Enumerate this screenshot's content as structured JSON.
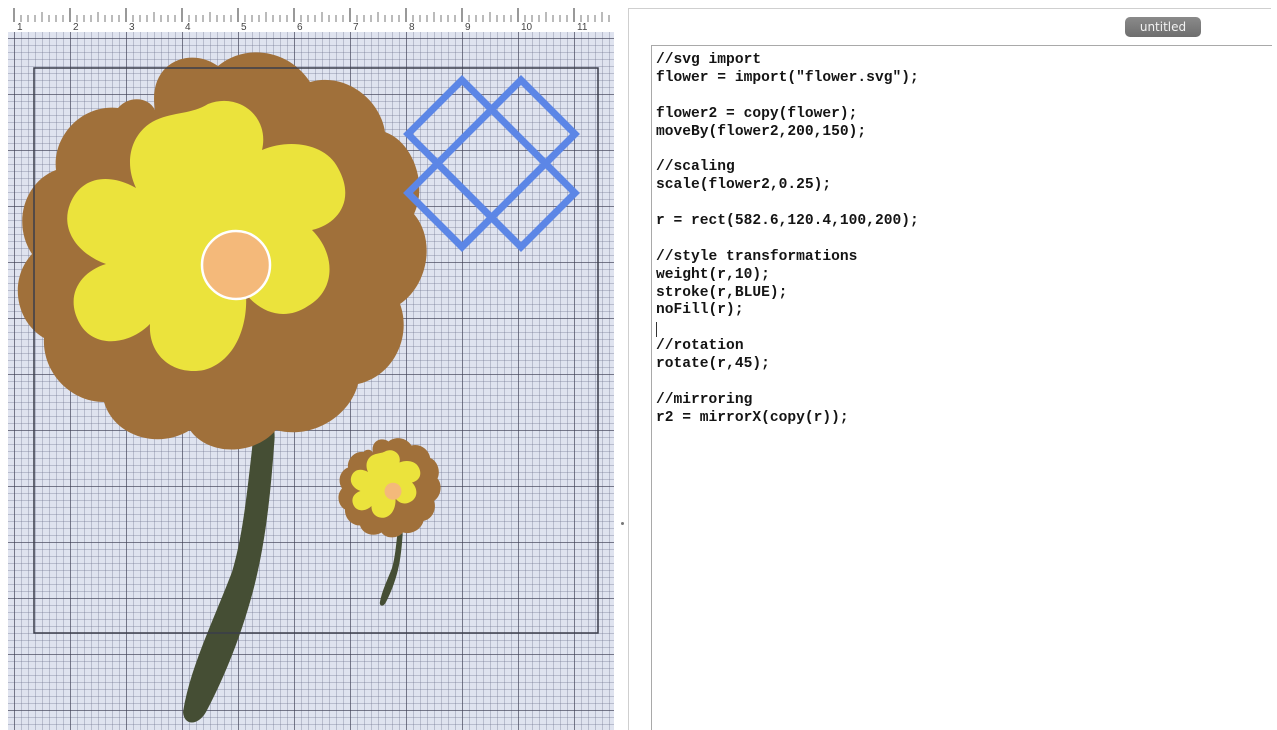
{
  "ruler": {
    "labels": [
      "1",
      "2",
      "3",
      "4",
      "5",
      "6",
      "7",
      "8",
      "9",
      "10",
      "11"
    ]
  },
  "canvas": {
    "shapes": [
      "frame-rect",
      "flower",
      "flower2",
      "r",
      "r2"
    ],
    "colors": {
      "petal_outer": "#a0703a",
      "petal_inner": "#ebe33c",
      "center": "#f4b97a",
      "stem": "#454e34",
      "rect_stroke": "#5c86e6",
      "grid_bg": "#dfe3ef"
    }
  },
  "editor": {
    "tab_label": "untitled",
    "code_lines": [
      "//svg import",
      "flower = import(\"flower.svg\");",
      "",
      "flower2 = copy(flower);",
      "moveBy(flower2,200,150);",
      "",
      "//scaling",
      "scale(flower2,0.25);",
      "",
      "r = rect(582.6,120.4,100,200);",
      "",
      "//style transformations",
      "weight(r,10);",
      "stroke(r,BLUE);",
      "noFill(r);",
      "",
      "//rotation",
      "rotate(r,45);",
      "",
      "//mirroring",
      "r2 = mirrorX(copy(r));"
    ]
  }
}
